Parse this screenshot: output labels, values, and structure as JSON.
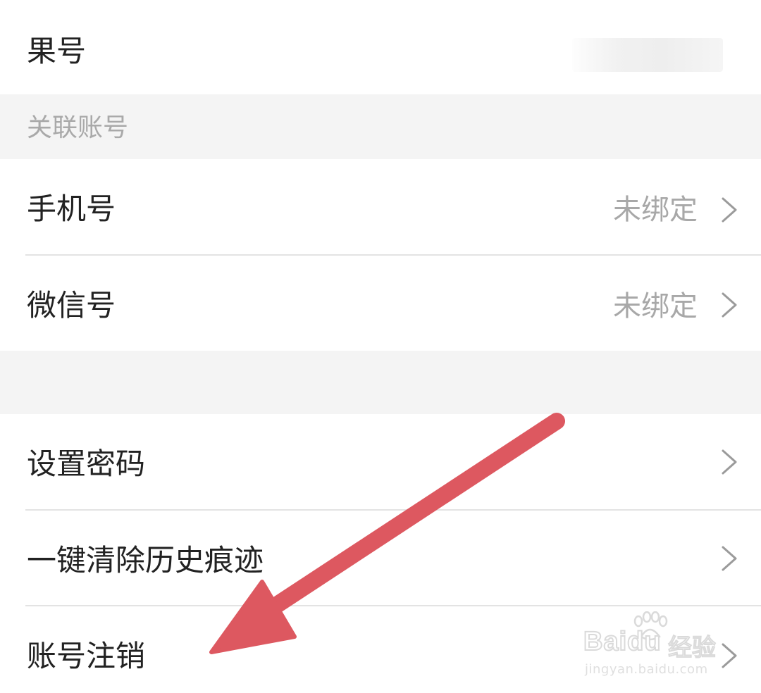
{
  "account": {
    "guohao_label": "果号"
  },
  "section_linked": {
    "title": "关联账号"
  },
  "linked": {
    "phone": {
      "label": "手机号",
      "status": "未绑定"
    },
    "wechat": {
      "label": "微信号",
      "status": "未绑定"
    }
  },
  "settings": {
    "set_password": {
      "label": "设置密码"
    },
    "clear_history": {
      "label": "一键清除历史痕迹"
    },
    "deregister": {
      "label": "账号注销"
    }
  },
  "watermark": {
    "brand": "Baidu",
    "brand_cn": "经验",
    "url": "jingyan.baidu.com"
  },
  "colors": {
    "annotation_arrow": "#dd5860",
    "section_bg": "#f4f4f4",
    "muted_text": "#a8a8a8",
    "primary_text": "#222222"
  },
  "icons": {
    "row_chevron": "chevron-right-icon",
    "arrow": "annotation-arrow"
  }
}
